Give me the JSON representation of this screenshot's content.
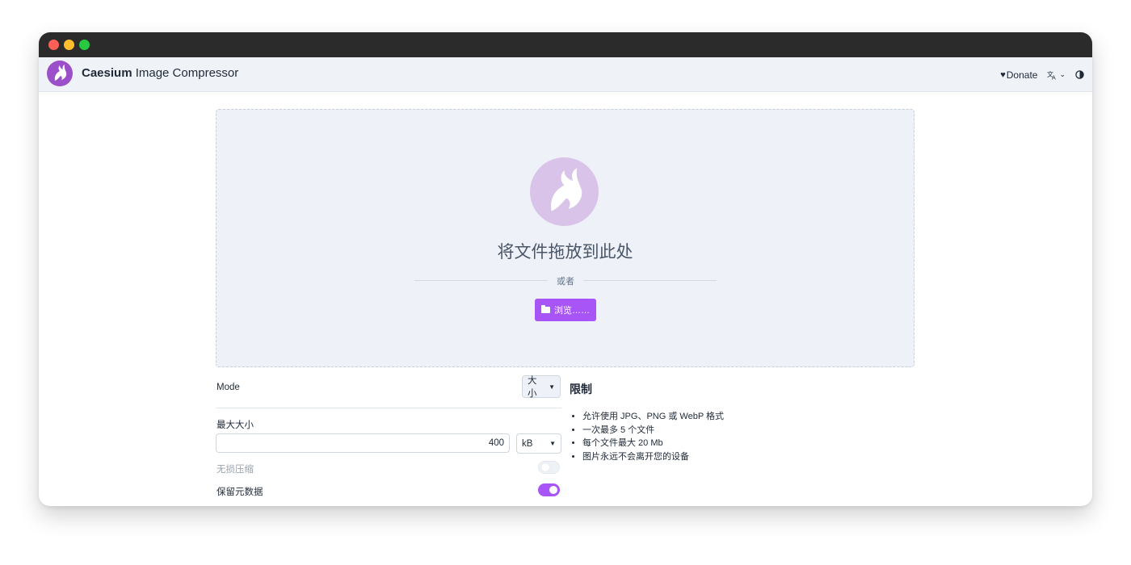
{
  "app": {
    "brand_bold": "Caesium",
    "brand_rest": " Image Compressor"
  },
  "nav": {
    "donate": "Donate",
    "language_icon": "translate-icon",
    "theme_icon": "contrast-icon"
  },
  "dropzone": {
    "title": "将文件拖放到此处",
    "or_text": "或者",
    "browse_label": "浏览……"
  },
  "settings": {
    "mode_label": "Mode",
    "mode_value": "大小",
    "max_size_label": "最大大小",
    "max_size_value": "400",
    "unit_value": "kB",
    "lossless_label": "无损压缩",
    "lossless_enabled": false,
    "keep_metadata_label": "保留元数据",
    "keep_metadata_enabled": true
  },
  "limits": {
    "title": "限制",
    "items": [
      "允许使用 JPG、PNG 或 WebP 格式",
      "一次最多 5 个文件",
      "每个文件最大 20 Mb",
      "图片永远不会离开您的设备"
    ]
  },
  "colors": {
    "accent": "#a855f7",
    "titlebar": "#2b2b2b",
    "appbar": "#eff3f8"
  }
}
